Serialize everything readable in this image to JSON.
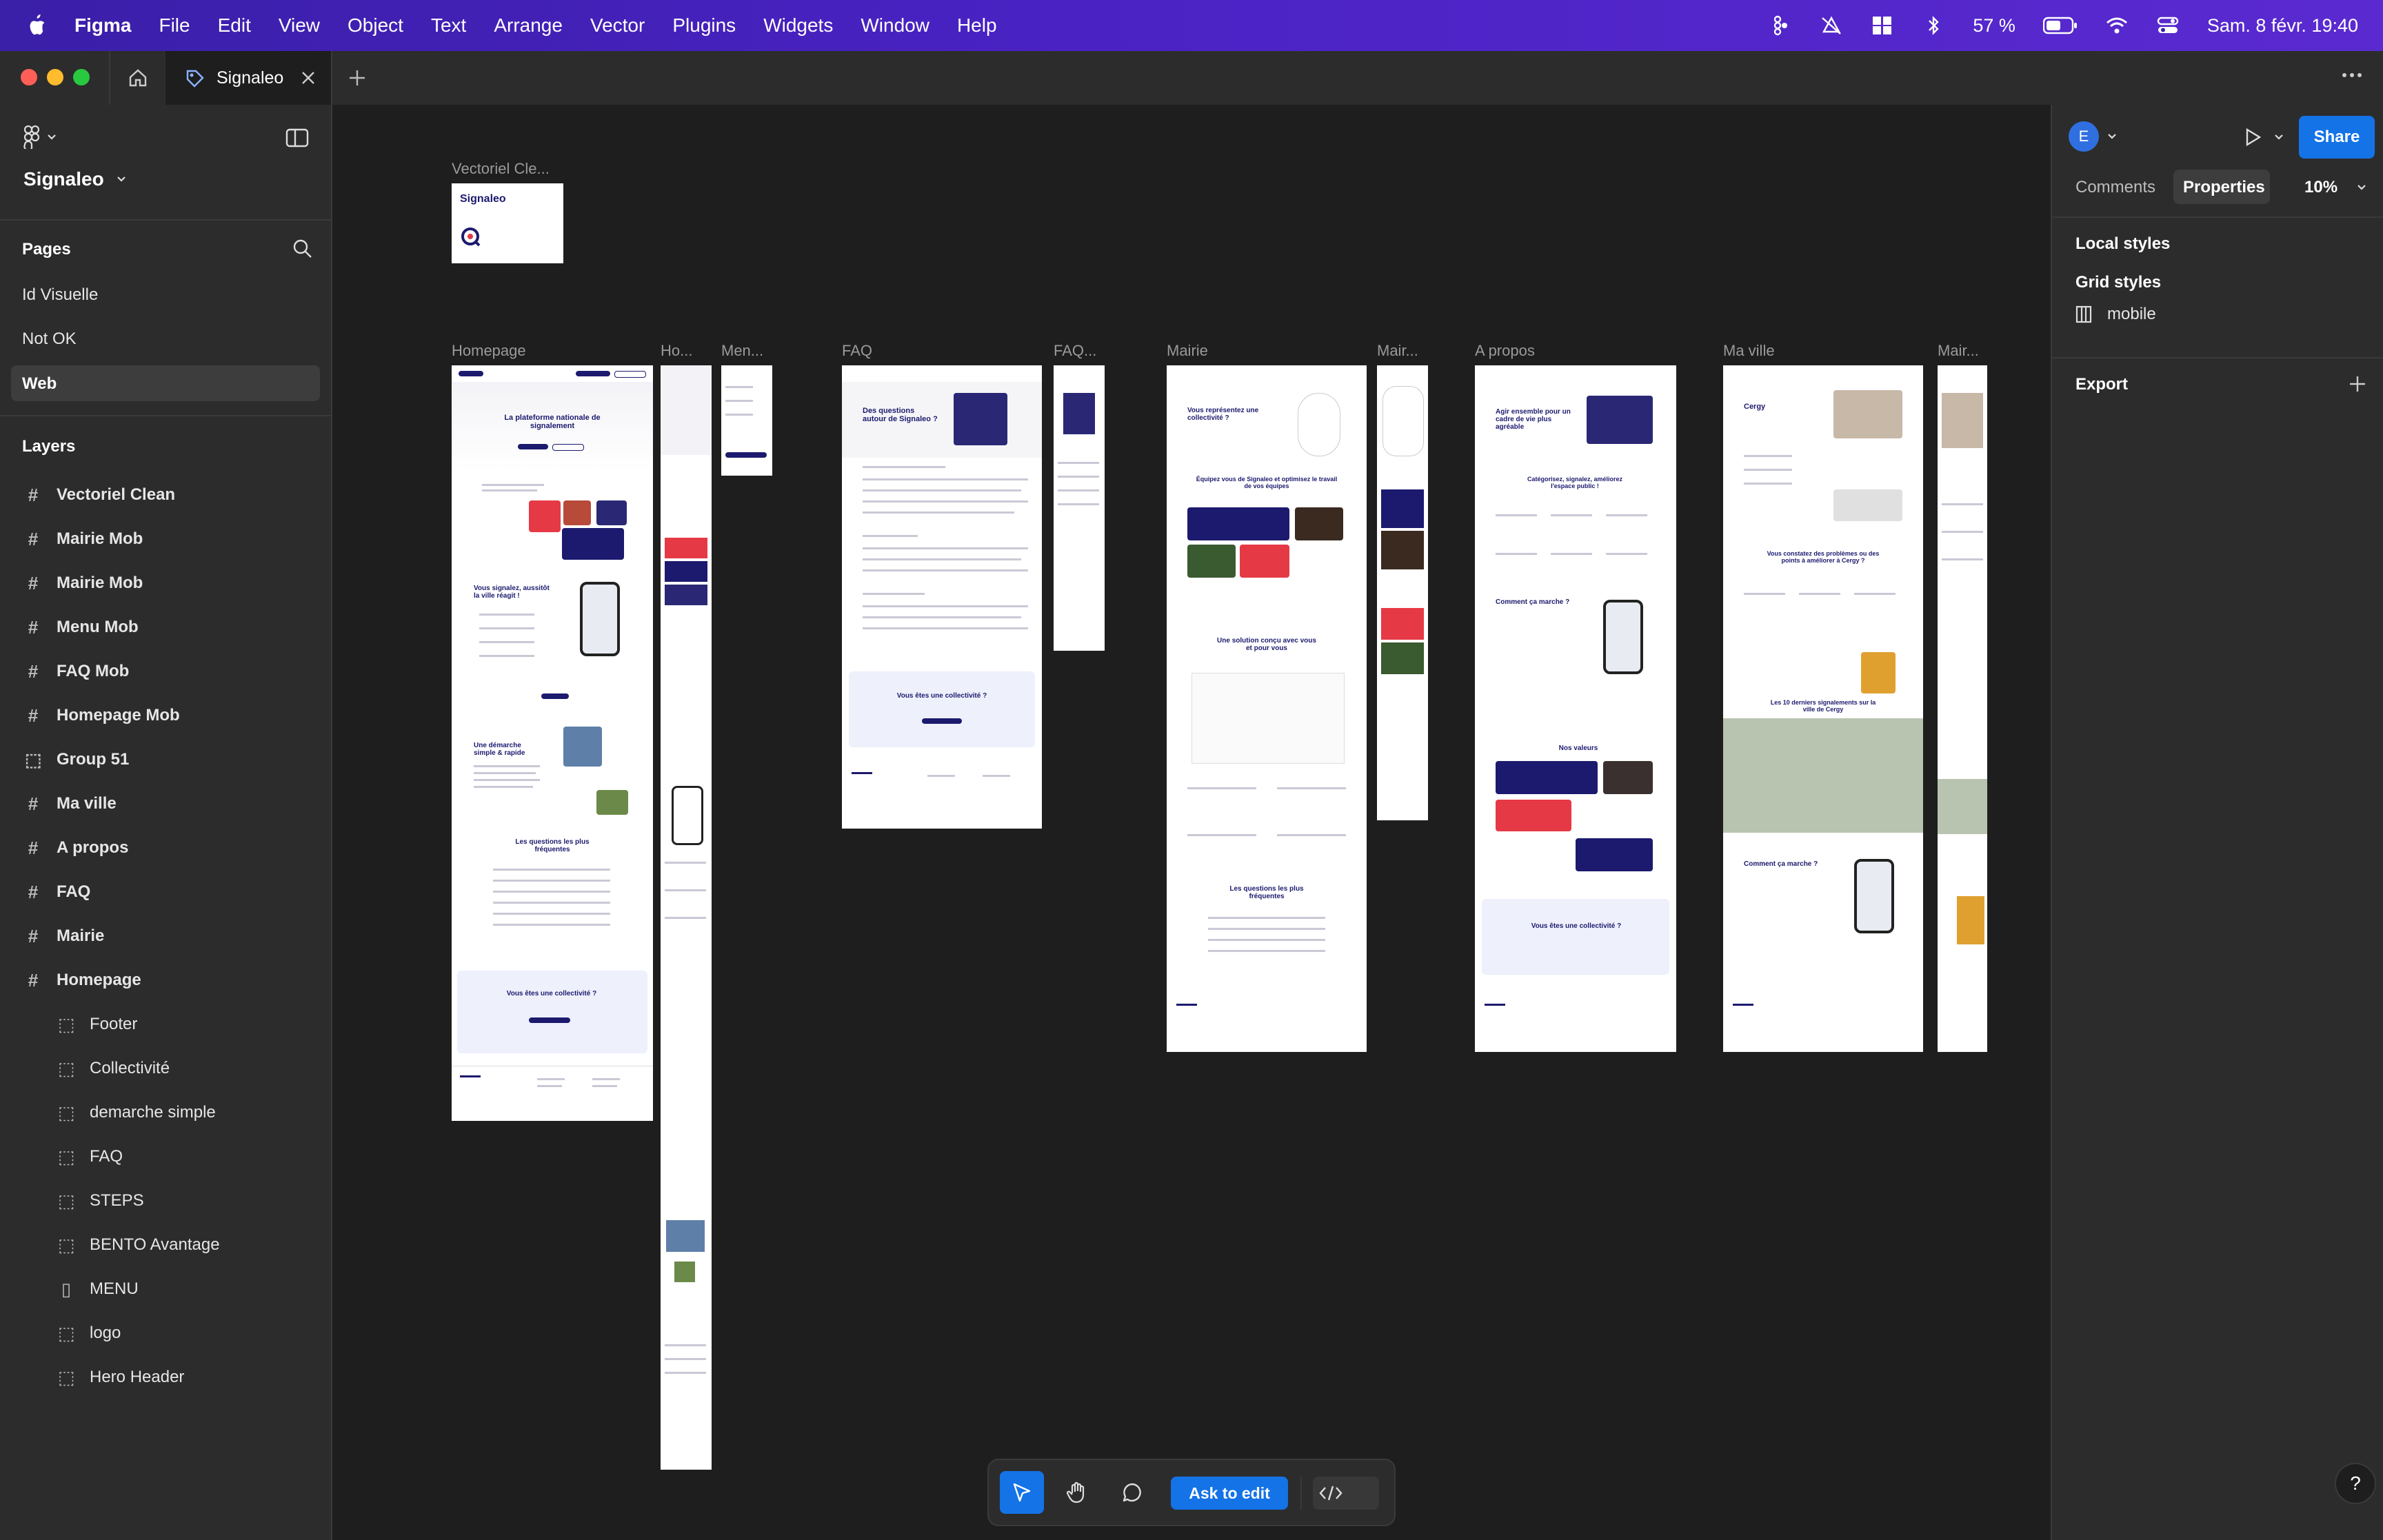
{
  "menubar": {
    "app": "Figma",
    "menus": [
      "File",
      "Edit",
      "View",
      "Object",
      "Text",
      "Arrange",
      "Vector",
      "Plugins",
      "Widgets",
      "Window",
      "Help"
    ],
    "battery": "57 %",
    "datetime": "Sam. 8 févr.  19:40"
  },
  "tabbar": {
    "tab_title": "Signaleo"
  },
  "left": {
    "file_name": "Signaleo",
    "pages_header": "Pages",
    "pages": [
      "Id Visuelle",
      "Not OK",
      "Web"
    ],
    "selected_page": "Web",
    "layers_header": "Layers",
    "layers": [
      {
        "label": "Vectoriel Clean",
        "kind": "frame"
      },
      {
        "label": "Mairie Mob",
        "kind": "frame"
      },
      {
        "label": "Mairie Mob",
        "kind": "frame"
      },
      {
        "label": "Menu Mob",
        "kind": "frame"
      },
      {
        "label": "FAQ Mob",
        "kind": "frame"
      },
      {
        "label": "Homepage Mob",
        "kind": "frame"
      },
      {
        "label": "Group 51",
        "kind": "group"
      },
      {
        "label": "Ma ville",
        "kind": "frame"
      },
      {
        "label": "A propos",
        "kind": "frame"
      },
      {
        "label": "FAQ",
        "kind": "frame"
      },
      {
        "label": "Mairie",
        "kind": "frame"
      },
      {
        "label": "Homepage",
        "kind": "frame"
      }
    ],
    "children": [
      {
        "label": "Footer",
        "kind": "group"
      },
      {
        "label": "Collectivité",
        "kind": "group"
      },
      {
        "label": "demarche simple",
        "kind": "group"
      },
      {
        "label": "FAQ",
        "kind": "group"
      },
      {
        "label": "STEPS",
        "kind": "group"
      },
      {
        "label": "BENTO Avantage",
        "kind": "group"
      },
      {
        "label": "MENU",
        "kind": "autolayout"
      },
      {
        "label": "logo",
        "kind": "group"
      },
      {
        "label": "Hero Header",
        "kind": "group"
      }
    ]
  },
  "canvas": {
    "frames": {
      "vectoriel": "Vectoriel Cle...",
      "homepage": "Homepage",
      "homepage_mob": "Ho...",
      "menu_mob": "Men...",
      "faq": "FAQ",
      "faq_mob": "FAQ...",
      "mairie": "Mairie",
      "mairie_mob": "Mair...",
      "apropos": "A propos",
      "maville": "Ma ville",
      "mairie_mob2": "Mair..."
    },
    "logo_text": "Signaleo",
    "home_hero": "La plateforme nationale de signalement",
    "home_signal": "Vous signalez, aussitôt la ville réagit !",
    "home_demarche": "Une démarche simple & rapide",
    "home_questions": "Les questions les plus fréquentes",
    "home_collectivite": "Vous êtes une collectivité ?",
    "faq_title": "Des questions autour de Signaleo ?",
    "faq_collectivite": "Vous êtes une collectivité ?",
    "mairie_title": "Vous représentez une collectivité ?",
    "mairie_equipez": "Équipez vous de Signaleo et optimisez le travail de vos équipes",
    "mairie_solution": "Une solution conçu avec vous et pour vous",
    "mairie_questions": "Les questions les plus fréquentes",
    "apropos_title": "Agir ensemble pour un cadre de vie plus agréable",
    "apropos_categories": "Catégorisez, signalez, améliorez l'espace public !",
    "apropos_comment": "Comment ça marche ?",
    "apropos_valeurs": "Nos valeurs",
    "apropos_collectivite": "Vous êtes une collectivité ?",
    "maville_title": "Cergy",
    "maville_constatez": "Vous constatez des problèmes ou des points à améliorer à Cergy ?",
    "maville_derniers": "Les 10 derniers signalements sur la ville de Cergy",
    "maville_comment": "Comment ça marche ?"
  },
  "right": {
    "avatar_initial": "E",
    "share": "Share",
    "tab_comments": "Comments",
    "tab_properties": "Properties",
    "zoom": "10%",
    "local_styles": "Local styles",
    "grid_styles": "Grid styles",
    "grid_style_item": "mobile",
    "export": "Export"
  },
  "toolbar": {
    "ask_to_edit": "Ask to edit"
  },
  "help": "?"
}
